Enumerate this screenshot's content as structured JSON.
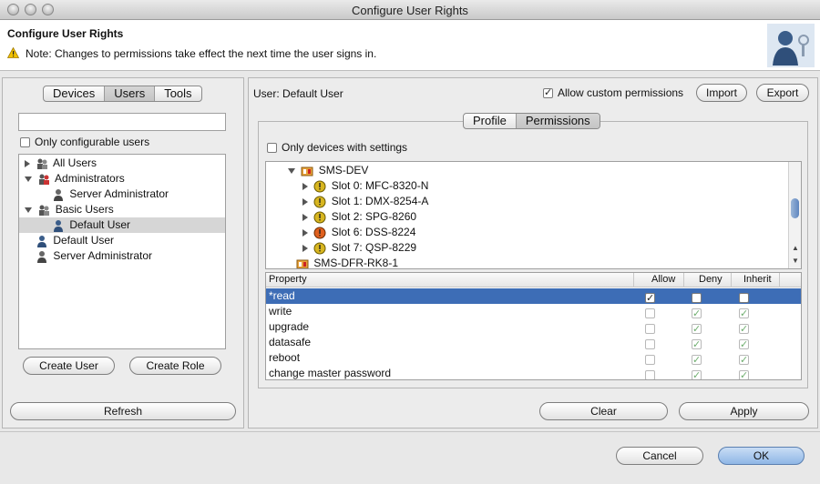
{
  "window": {
    "title": "Configure User Rights"
  },
  "header": {
    "title": "Configure User Rights",
    "note": "Note: Changes to permissions take effect the next time the user signs in."
  },
  "left": {
    "tabs": [
      "Devices",
      "Users",
      "Tools"
    ],
    "selected_tab": "Users",
    "search": {
      "value": "",
      "placeholder": ""
    },
    "only_configurable": {
      "label": "Only configurable users",
      "checked": false
    },
    "tree": [
      {
        "label": "All Users",
        "level": 0,
        "expander": "right",
        "icon": "group-icon"
      },
      {
        "label": "Administrators",
        "level": 0,
        "expander": "down",
        "icon": "admin-group-icon"
      },
      {
        "label": "Server Administrator",
        "level": 1,
        "expander": "",
        "icon": "user-icon"
      },
      {
        "label": "Basic Users",
        "level": 0,
        "expander": "down",
        "icon": "group-icon"
      },
      {
        "label": "Default User",
        "level": 1,
        "expander": "",
        "icon": "user-icon",
        "selected": true
      },
      {
        "label": "Default User",
        "level": 0,
        "expander": "",
        "icon": "user-icon"
      },
      {
        "label": "Server Administrator",
        "level": 0,
        "expander": "",
        "icon": "user-icon"
      }
    ],
    "create_user": "Create User",
    "create_role": "Create Role",
    "refresh": "Refresh"
  },
  "right": {
    "user_label": "User: Default User",
    "allow_custom": {
      "label": "Allow custom permissions",
      "checked": true
    },
    "import": "Import",
    "export": "Export",
    "tabs": [
      "Profile",
      "Permissions"
    ],
    "selected_tab": "Permissions",
    "only_devices": {
      "label": "Only devices with settings",
      "checked": false
    },
    "device_tree": [
      {
        "label": "SMS-DEV",
        "level": 0,
        "expander": "down",
        "icon": "device-icon"
      },
      {
        "label": "Slot 0: MFC-8320-N",
        "level": 1,
        "expander": "right",
        "icon": "slot-warning-icon"
      },
      {
        "label": "Slot 1: DMX-8254-A",
        "level": 1,
        "expander": "right",
        "icon": "slot-warning-icon"
      },
      {
        "label": "Slot 2: SPG-8260",
        "level": 1,
        "expander": "right",
        "icon": "slot-warning-icon"
      },
      {
        "label": "Slot 6: DSS-8224",
        "level": 1,
        "expander": "right",
        "icon": "slot-error-icon"
      },
      {
        "label": "Slot 7: QSP-8229",
        "level": 1,
        "expander": "right",
        "icon": "slot-warning-icon"
      },
      {
        "label": "SMS-DFR-RK8-1",
        "level": 0,
        "expander": "",
        "icon": "device-icon"
      }
    ],
    "columns": {
      "property": "Property",
      "allow": "Allow",
      "deny": "Deny",
      "inherit": "Inherit"
    },
    "permissions": [
      {
        "name": "*read",
        "allow": true,
        "deny": false,
        "inherit": false,
        "selected": true
      },
      {
        "name": "write",
        "allow": false,
        "deny": true,
        "inherit": true
      },
      {
        "name": "upgrade",
        "allow": false,
        "deny": true,
        "inherit": true
      },
      {
        "name": "datasafe",
        "allow": false,
        "deny": true,
        "inherit": true
      },
      {
        "name": "reboot",
        "allow": false,
        "deny": true,
        "inherit": true
      },
      {
        "name": "change master password",
        "allow": false,
        "deny": true,
        "inherit": true
      }
    ],
    "clear": "Clear",
    "apply": "Apply"
  },
  "footer": {
    "cancel": "Cancel",
    "ok": "OK"
  },
  "colors": {
    "selection": "#3d6db6",
    "primary_button": "#8fb7e6",
    "warning": "#f2c200"
  }
}
